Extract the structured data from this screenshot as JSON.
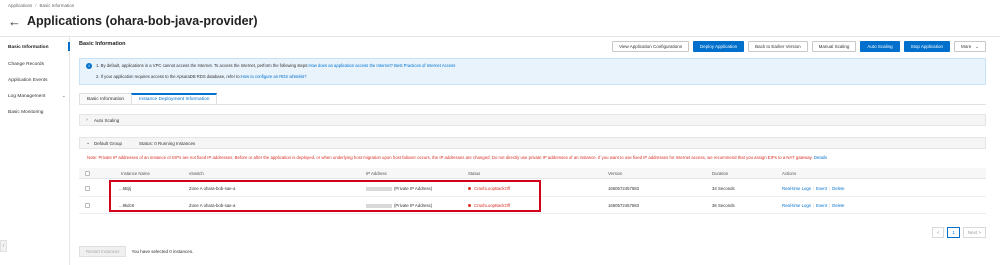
{
  "breadcrumb": [
    "Applications",
    "Basic Information"
  ],
  "page_title": "Applications (ohara-bob-java-provider)",
  "sidebar": {
    "items": [
      {
        "label": "Basic Information",
        "active": true
      },
      {
        "label": "Change Records"
      },
      {
        "label": "Application Events"
      },
      {
        "label": "Log Management",
        "expandable": true
      },
      {
        "label": "Basic Monitoring"
      }
    ]
  },
  "section_title": "Basic Information",
  "actions": {
    "view_config": "View Application Configurations",
    "deploy": "Deploy Application",
    "rollback": "Back to Earlier Version",
    "manual_scaling": "Manual Scaling",
    "auto_scaling": "Auto Scaling",
    "stop": "Stop Application",
    "more": "More"
  },
  "notice": {
    "line1_text": "1. By default, applications in a VPC cannot access the Internet. To access the Internet, perform the following steps:",
    "line1_link": "How does an application access the Internet? Best Practices of Internet Access",
    "line2_text": "2. If your application requires access to the ApsaraDB RDS database, refer to:",
    "line2_link": "How to configure an RDS whitelist?"
  },
  "tabs": [
    "Basic Information",
    "Instance Deployment Information"
  ],
  "auto_scaling_label": "Auto Scaling",
  "group": {
    "label": "Default Group",
    "status": "Status: 0 Running Instances"
  },
  "note_text": "Note: Private IP addresses of an instance or EIPs are not fixed IP addresses. Before or after the application is deployed, or when underlying host migration upon host failover occurs, the IP addresses are changed. Do not directly use private IP addresses of an instance. If you want to use fixed IP addresses for Internet access, we recommend that you assign EIPs to a NAT gateway.",
  "note_link": "Details",
  "table": {
    "headers": [
      "Instance Name",
      "vSwitch",
      "IP Address",
      "Status",
      "Version",
      "Duration",
      "Actions"
    ],
    "rows": [
      {
        "name": "...5Bjrj",
        "vswitch": "Zone A ohara-bob-sae-a",
        "ip_suffix": "(Private IP Address)",
        "status": "CrashLoopBackOff",
        "version": "1660572457683",
        "duration": "34 Seconds",
        "actions": [
          "Real-time Logs",
          "Event",
          "Delete"
        ]
      },
      {
        "name": "...9kdc8",
        "vswitch": "Zone A ohara-bob-sae-a",
        "ip_suffix": "(Private IP Address)",
        "status": "CrashLoopBackOff",
        "version": "1660572457683",
        "duration": "36 Seconds",
        "actions": [
          "Real-time Logs",
          "Event",
          "Delete"
        ]
      }
    ]
  },
  "pagination": {
    "prev": "<",
    "page": "1",
    "next": "Next >"
  },
  "restart_button": "Restart Instances",
  "selection_text": "You have selected 0 instances.",
  "colors": {
    "primary": "#0070cc",
    "error": "#d93026",
    "highlight_box": "#d0021b"
  }
}
